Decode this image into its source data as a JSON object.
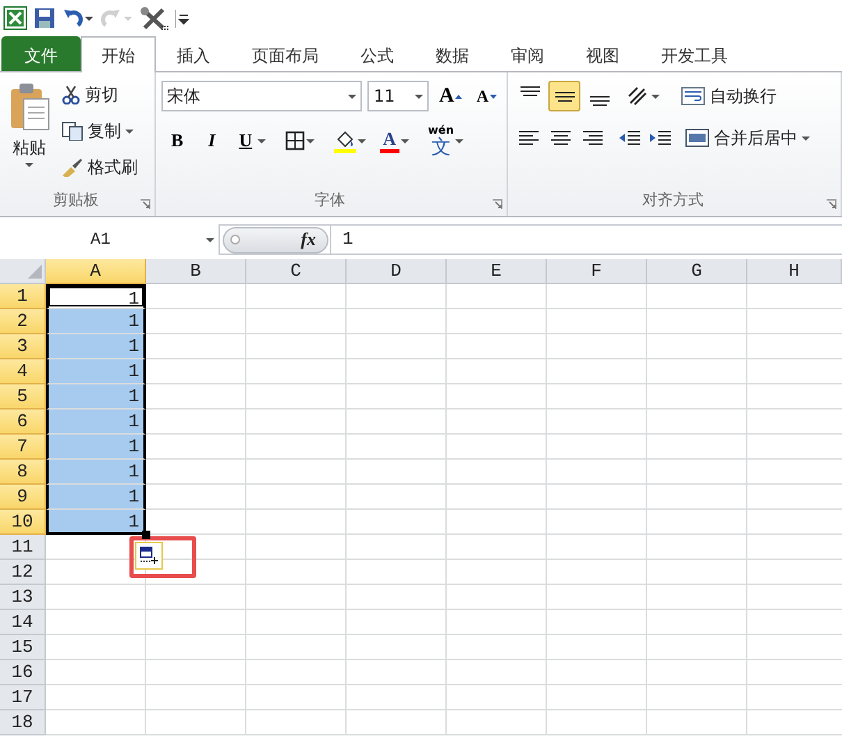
{
  "quick_access": {
    "items": [
      {
        "kind": "excel"
      },
      {
        "kind": "save"
      },
      {
        "kind": "undo"
      },
      {
        "kind": "redo",
        "disabled": true
      },
      {
        "kind": "tools"
      },
      {
        "kind": "customize"
      }
    ]
  },
  "tabs": [
    {
      "label": "文件",
      "kind": "file",
      "selected": false
    },
    {
      "label": "开始",
      "kind": "tab",
      "selected": true
    },
    {
      "label": "插入",
      "kind": "tab",
      "selected": false
    },
    {
      "label": "页面布局",
      "kind": "tab",
      "selected": false
    },
    {
      "label": "公式",
      "kind": "tab",
      "selected": false
    },
    {
      "label": "数据",
      "kind": "tab",
      "selected": false
    },
    {
      "label": "审阅",
      "kind": "tab",
      "selected": false
    },
    {
      "label": "视图",
      "kind": "tab",
      "selected": false
    },
    {
      "label": "开发工具",
      "kind": "tab",
      "selected": false
    }
  ],
  "clipboard": {
    "label": "剪贴板",
    "paste": "粘贴",
    "cut": "剪切",
    "copy": "复制",
    "format_painter": "格式刷"
  },
  "font": {
    "label": "字体",
    "font_name": "宋体",
    "font_size": "11",
    "grow": "A",
    "shrink": "A",
    "bold": "B",
    "italic": "I",
    "underline": "U",
    "font_color": "A",
    "phonetic_top": "wén",
    "phonetic_char": "文"
  },
  "alignment": {
    "label": "对齐方式",
    "vertical": [
      {
        "kind": "top",
        "selected": false
      },
      {
        "kind": "middle",
        "selected": true
      },
      {
        "kind": "bottom",
        "selected": false
      }
    ],
    "wrap_text": "自动换行",
    "merge_center": "合并后居中"
  },
  "formula_bar": {
    "name_box": "A1",
    "function_label": "fx",
    "value": "1"
  },
  "columns": [
    {
      "label": "A",
      "selected": true
    },
    {
      "label": "B",
      "selected": false
    },
    {
      "label": "C",
      "selected": false
    },
    {
      "label": "D",
      "selected": false
    },
    {
      "label": "E",
      "selected": false
    },
    {
      "label": "F",
      "selected": false
    },
    {
      "label": "G",
      "selected": false
    },
    {
      "label": "H",
      "selected": false
    }
  ],
  "rows": [
    {
      "number": "1",
      "selected": true,
      "active": true,
      "value": "1"
    },
    {
      "number": "2",
      "selected": true,
      "active": false,
      "value": "1"
    },
    {
      "number": "3",
      "selected": true,
      "active": false,
      "value": "1"
    },
    {
      "number": "4",
      "selected": true,
      "active": false,
      "value": "1"
    },
    {
      "number": "5",
      "selected": true,
      "active": false,
      "value": "1"
    },
    {
      "number": "6",
      "selected": true,
      "active": false,
      "value": "1"
    },
    {
      "number": "7",
      "selected": true,
      "active": false,
      "value": "1"
    },
    {
      "number": "8",
      "selected": true,
      "active": false,
      "value": "1"
    },
    {
      "number": "9",
      "selected": true,
      "active": false,
      "value": "1"
    },
    {
      "number": "10",
      "selected": true,
      "active": false,
      "value": "1"
    },
    {
      "number": "11",
      "selected": false,
      "active": false
    },
    {
      "number": "12",
      "selected": false,
      "active": false
    },
    {
      "number": "13",
      "selected": false,
      "active": false
    },
    {
      "number": "14",
      "selected": false,
      "active": false
    },
    {
      "number": "15",
      "selected": false,
      "active": false
    },
    {
      "number": "16",
      "selected": false,
      "active": false
    },
    {
      "number": "17",
      "selected": false,
      "active": false
    },
    {
      "number": "18",
      "selected": false,
      "active": false
    }
  ],
  "autofill_options": {
    "highlighted": true
  }
}
